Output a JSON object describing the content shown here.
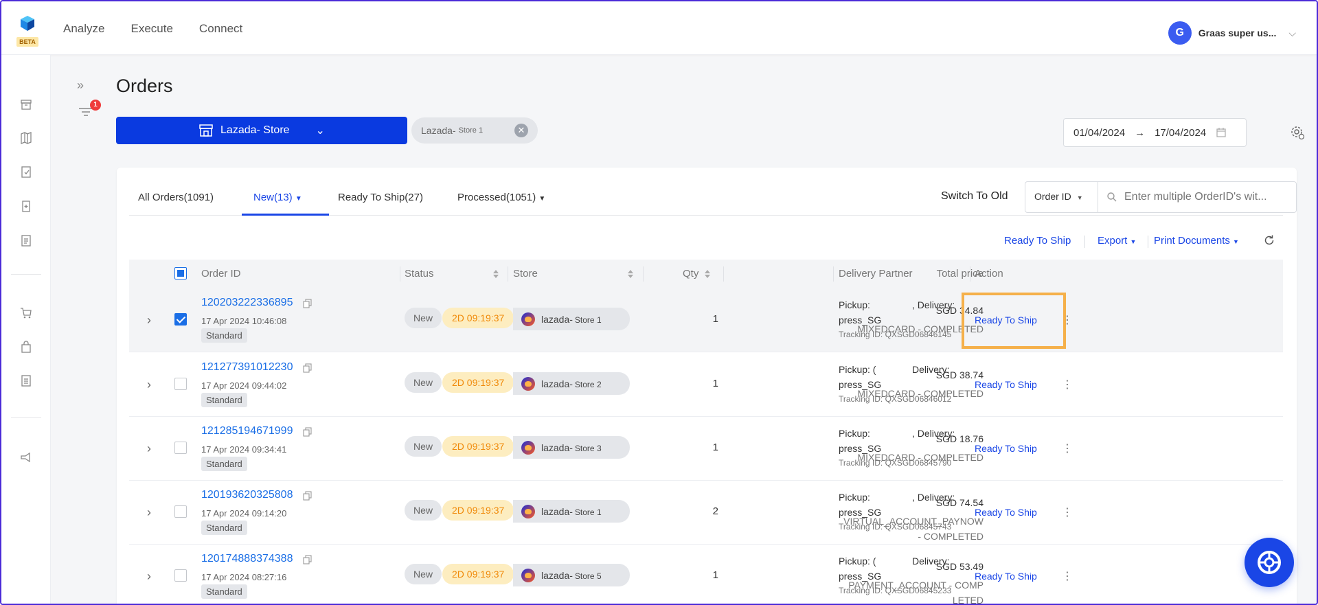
{
  "app": {
    "beta_label": "BETA",
    "nav": [
      "Analyze",
      "Execute",
      "Connect"
    ],
    "user": {
      "initial": "G",
      "name": "Graas super us..."
    }
  },
  "page": {
    "title": "Orders",
    "filter_count": "1",
    "store_button": "Lazada- Store",
    "chip": {
      "label": "Lazada-",
      "sub": "Store 1"
    },
    "date_from": "01/04/2024",
    "date_to": "17/04/2024",
    "date_arrow": "→"
  },
  "tabs": [
    {
      "label": "All Orders(1091)"
    },
    {
      "label": "New(13)"
    },
    {
      "label": "Ready To Ship(27)"
    },
    {
      "label": "Processed(1051)"
    }
  ],
  "search": {
    "switch_old": "Switch To Old",
    "selector": "Order ID",
    "placeholder": "Enter multiple OrderID's wit..."
  },
  "actions": {
    "ready_to_ship": "Ready To Ship",
    "export": "Export",
    "print": "Print Documents"
  },
  "columns": {
    "order_id": "Order ID",
    "status": "Status",
    "store": "Store",
    "qty": "Qty",
    "total": "Total price",
    "delivery": "Delivery Partner",
    "action": "Action"
  },
  "rows": [
    {
      "id": "120203222336895",
      "date": "17 Apr 2024 10:46:08",
      "type": "Standard",
      "status": "New",
      "timer": "2D 09:19:37",
      "store": "lazada-",
      "store_sub": "Store 1",
      "qty": "1",
      "price": "SGD 34.84",
      "pay1": "MIXEDCARD - COMPLETED",
      "pay2": "",
      "pickup": "Pickup:",
      "delivery": ", Delivery:",
      "press": "press_SG",
      "tracking": "Tracking ID: QXSGD06846145",
      "action": "Ready To Ship",
      "checked": true
    },
    {
      "id": "121277391012230",
      "date": "17 Apr 2024 09:44:02",
      "type": "Standard",
      "status": "New",
      "timer": "2D 09:19:37",
      "store": "lazada-",
      "store_sub": "Store 2",
      "qty": "1",
      "price": "SGD 38.74",
      "pay1": "MIXEDCARD - COMPLETED",
      "pay2": "",
      "pickup": "Pickup: (",
      "delivery": "Delivery:",
      "press": "press_SG",
      "tracking": "Tracking ID: QXSGD06846012",
      "action": "Ready To Ship",
      "checked": false
    },
    {
      "id": "121285194671999",
      "date": "17 Apr 2024 09:34:41",
      "type": "Standard",
      "status": "New",
      "timer": "2D 09:19:37",
      "store": "lazada-",
      "store_sub": "Store 3",
      "qty": "1",
      "price": "SGD 18.76",
      "pay1": "MIXEDCARD - COMPLETED",
      "pay2": "",
      "pickup": "Pickup:",
      "delivery": ", Delivery:",
      "press": "press_SG",
      "tracking": "Tracking ID: QXSGD06845790",
      "action": "Ready To Ship",
      "checked": false
    },
    {
      "id": "120193620325808",
      "date": "17 Apr 2024 09:14:20",
      "type": "Standard",
      "status": "New",
      "timer": "2D 09:19:37",
      "store": "lazada-",
      "store_sub": "Store 1",
      "qty": "2",
      "price": "SGD 74.54",
      "pay1": "VIRTUAL_ACCOUNT_PAYNOW",
      "pay2": "- COMPLETED",
      "pickup": "Pickup:",
      "delivery": ", Delivery:",
      "press": "press_SG",
      "tracking": "Tracking ID: QXSGD06845743",
      "action": "Ready To Ship",
      "checked": false
    },
    {
      "id": "120174888374388",
      "date": "17 Apr 2024 08:27:16",
      "type": "Standard",
      "status": "New",
      "timer": "2D 09:19:37",
      "store": "lazada-",
      "store_sub": "Store 5",
      "qty": "1",
      "price": "SGD 53.49",
      "pay1": "PAYMENT_ACCOUNT - COMP",
      "pay2": "LETED",
      "pickup": "Pickup: (",
      "delivery": "Delivery:",
      "press": "press_SG",
      "tracking": "Tracking ID: QXSGD06845233",
      "action": "Ready To Ship",
      "checked": false
    }
  ],
  "colors": {
    "primary": "#0a3ae0",
    "link": "#1a6ee6",
    "timer_bg": "#fdedc0",
    "highlight": "#f5b04a"
  }
}
